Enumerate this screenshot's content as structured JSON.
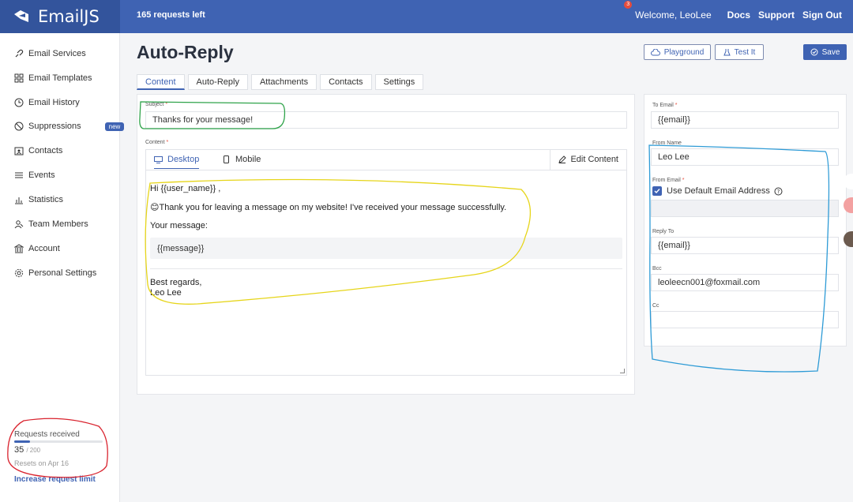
{
  "topbar": {
    "logo_text": "EmailJS",
    "requests_left": "165 requests left",
    "notification_count": "3",
    "welcome": "Welcome, LeoLee",
    "docs": "Docs",
    "support": "Support",
    "sign_out": "Sign Out"
  },
  "sidebar": {
    "items": [
      {
        "label": "Email Services",
        "icon": "link-icon"
      },
      {
        "label": "Email Templates",
        "icon": "template-grid-icon"
      },
      {
        "label": "Email History",
        "icon": "history-icon"
      },
      {
        "label": "Suppressions",
        "icon": "block-icon",
        "badge": "new"
      },
      {
        "label": "Contacts",
        "icon": "contacts-icon"
      },
      {
        "label": "Events",
        "icon": "list-icon"
      },
      {
        "label": "Statistics",
        "icon": "chart-icon"
      },
      {
        "label": "Team Members",
        "icon": "team-icon"
      },
      {
        "label": "Account",
        "icon": "bank-icon"
      },
      {
        "label": "Personal Settings",
        "icon": "gear-icon"
      }
    ],
    "usage": {
      "title": "Requests received",
      "count": "35",
      "max": "/ 200",
      "fill_fraction": 0.175,
      "reset": "Resets on Apr 16",
      "increase_link": "Increase request limit"
    }
  },
  "header": {
    "title": "Auto-Reply",
    "playground": "Playground",
    "test_it": "Test It",
    "save": "Save"
  },
  "tabs": [
    "Content",
    "Auto-Reply",
    "Attachments",
    "Contacts",
    "Settings"
  ],
  "content": {
    "subject_label": "Subject",
    "subject_value": "Thanks for your message!",
    "content_label": "Content",
    "editor_tab_desktop": "Desktop",
    "editor_tab_mobile": "Mobile",
    "edit_content": "Edit Content",
    "greeting": "Hi {{user_name}} ,",
    "emoji": "😊",
    "thanks_line": "Thank you for leaving a message on my website! I've received your message successfully.",
    "your_message": "Your message:",
    "message_var": "{{message}}",
    "regards": "Best regards,",
    "signature": "Leo Lee"
  },
  "right_panel": {
    "to_email_label": "To Email",
    "to_email_value": "{{email}}",
    "from_name_label": "From Name",
    "from_name_value": "Leo Lee",
    "from_email_label": "From Email",
    "use_default_label": "Use Default Email Address",
    "reply_to_label": "Reply To",
    "reply_to_value": "{{email}}",
    "bcc_label": "Bcc",
    "bcc_value": "leoleecn001@foxmail.com",
    "cc_label": "Cc",
    "cc_value": ""
  },
  "colors": {
    "brand": "#3f63b3",
    "annotation_green": "#2fa34a",
    "annotation_yellow": "#e6d51a",
    "annotation_blue": "#2e9bd6",
    "annotation_red": "#d9232e"
  }
}
